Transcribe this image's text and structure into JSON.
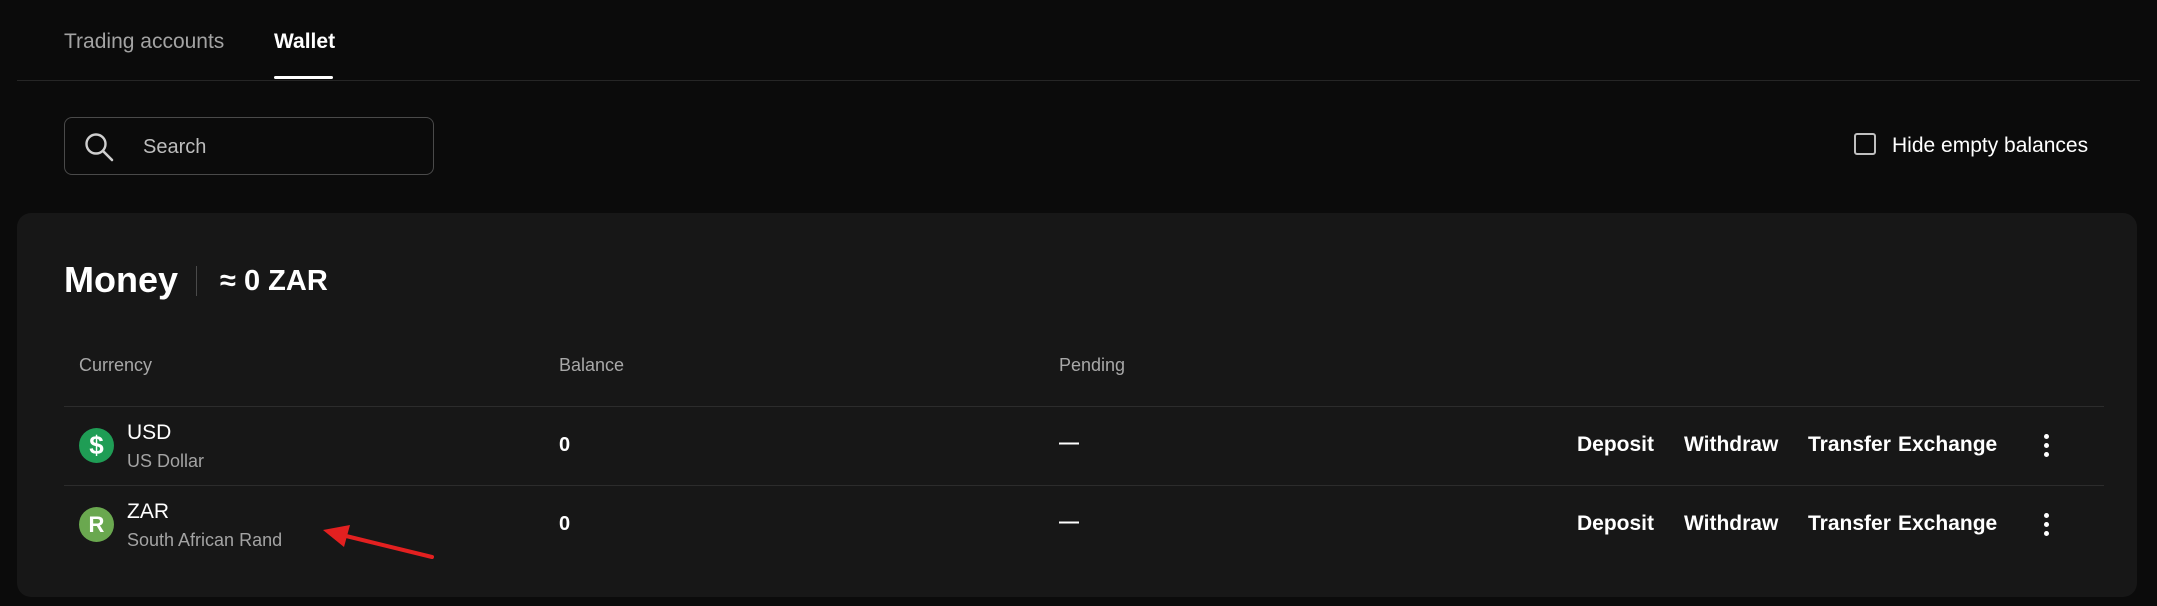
{
  "tabs": {
    "trading_accounts": "Trading accounts",
    "wallet": "Wallet"
  },
  "search": {
    "placeholder": "Search"
  },
  "filters": {
    "hide_empty_label": "Hide empty balances",
    "hide_empty_checked": false
  },
  "money": {
    "title": "Money",
    "total": "≈ 0 ZAR",
    "columns": {
      "currency": "Currency",
      "balance": "Balance",
      "pending": "Pending"
    },
    "rows": [
      {
        "icon_symbol": "$",
        "icon_color": "#1f9d55",
        "code": "USD",
        "name": "US Dollar",
        "balance": "0",
        "pending": "—"
      },
      {
        "icon_symbol": "R",
        "icon_color": "#6aa84f",
        "code": "ZAR",
        "name": "South African Rand",
        "balance": "0",
        "pending": "—"
      }
    ],
    "actions": {
      "deposit": "Deposit",
      "withdraw": "Withdraw",
      "transfer": "Transfer",
      "exchange": "Exchange"
    }
  },
  "colors": {
    "background": "#0b0b0b",
    "card": "#171717",
    "annotation_arrow": "#e32020"
  }
}
